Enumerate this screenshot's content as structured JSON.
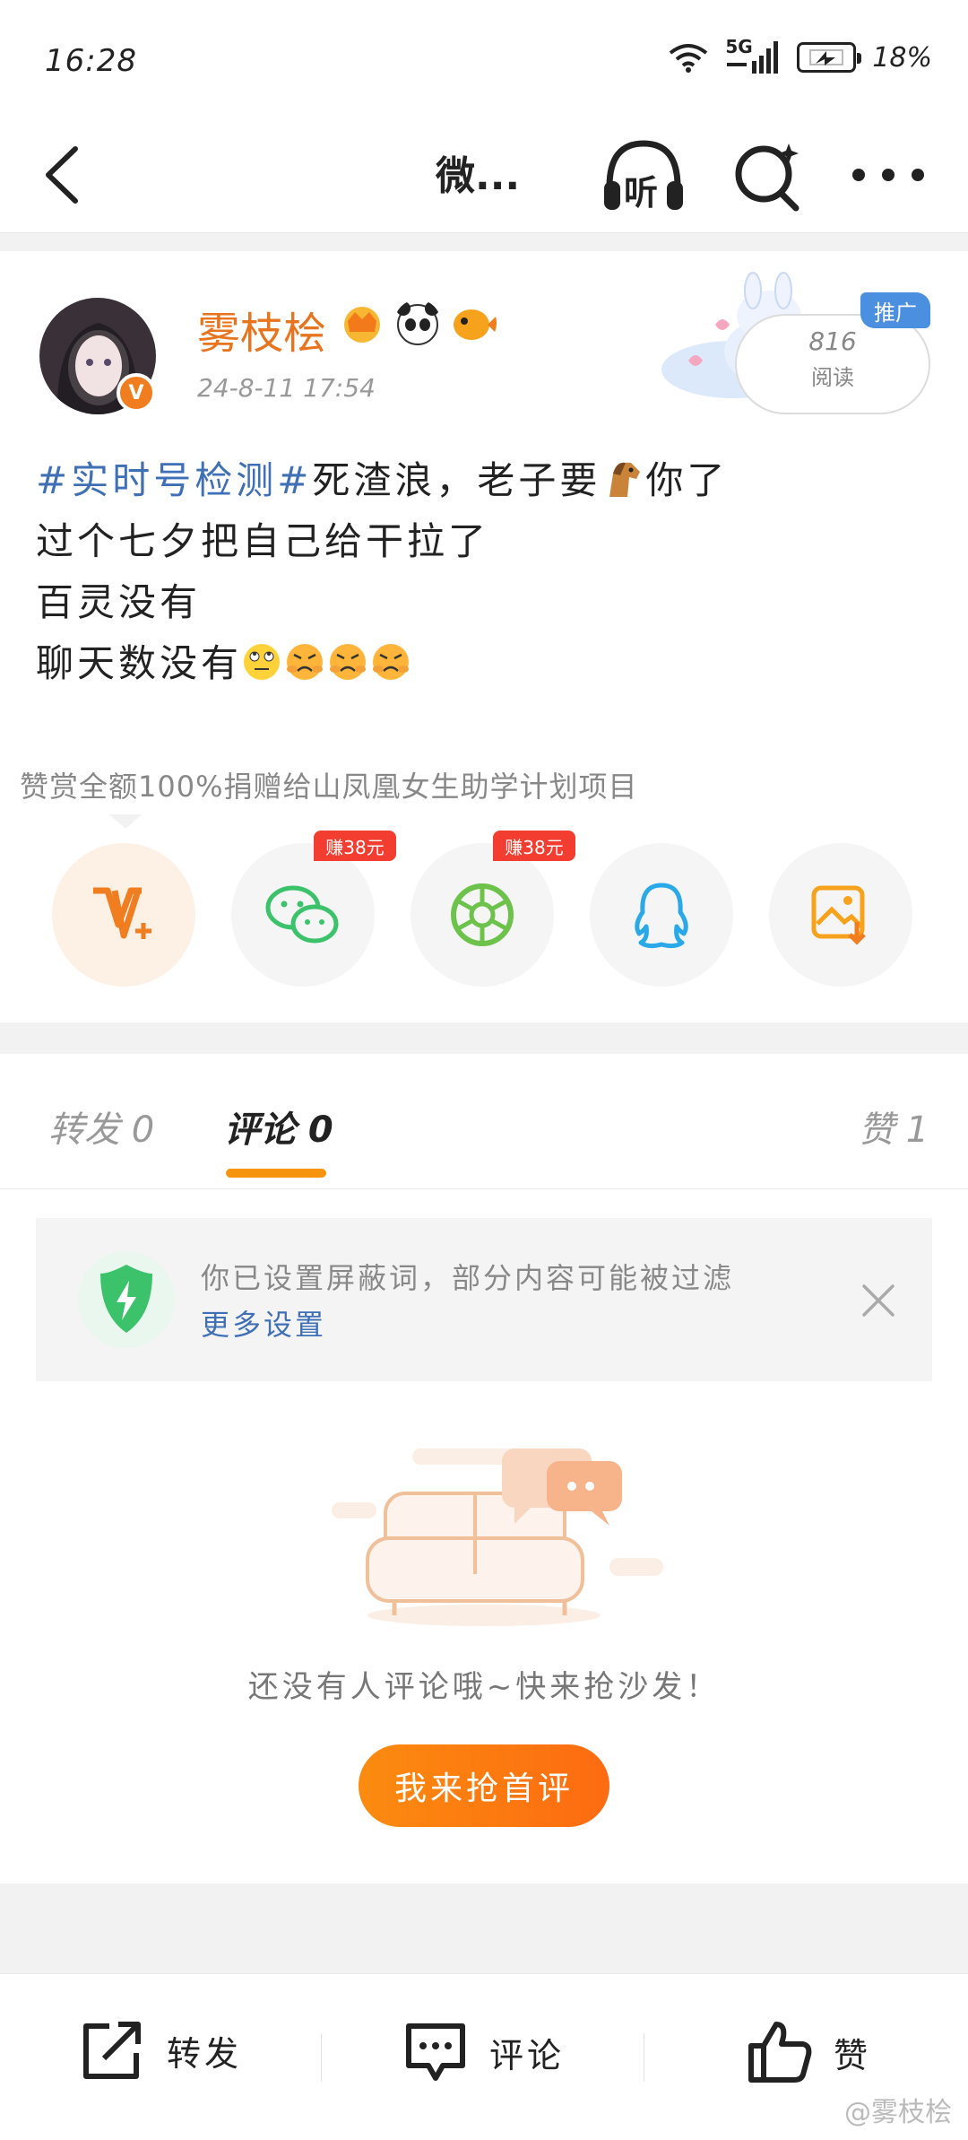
{
  "status_bar": {
    "time": "16:28",
    "network": "5G",
    "battery": "18%"
  },
  "nav": {
    "title": "微...",
    "listen_label": "听"
  },
  "post": {
    "username": "雾枝桧",
    "date": "24-8-11 17:54",
    "promo_tag": "推广",
    "read_count": "816",
    "read_label": "阅读",
    "hashtag": "#实时号检测#",
    "line1_a": "死渣浪，老子要",
    "line1_b": "你了",
    "line2": "过个七夕把自己给干拉了",
    "line3": "百灵没有",
    "line4": "聊天数没有",
    "avatar_badge": "V",
    "donation": "赞赏全额100%捐赠给山凤凰女生助学计划项目"
  },
  "share": {
    "earn_badge_1": "赚38元",
    "earn_badge_2": "赚38元"
  },
  "tabs": {
    "repost": "转发 0",
    "comment": "评论 0",
    "like": "赞 1"
  },
  "notice": {
    "text": "你已设置屏蔽词，部分内容可能被过滤",
    "link": "更多设置"
  },
  "empty": {
    "message": "还没有人评论哦~快来抢沙发！",
    "button": "我来抢首评"
  },
  "bottom_bar": {
    "repost": "转发",
    "comment": "评论",
    "like": "赞"
  },
  "watermark": "@雾枝桧",
  "colors": {
    "accent_orange": "#f7940e",
    "link_blue": "#3f6fb5",
    "name_orange": "#e7741f",
    "badge_red": "#f23d30"
  }
}
